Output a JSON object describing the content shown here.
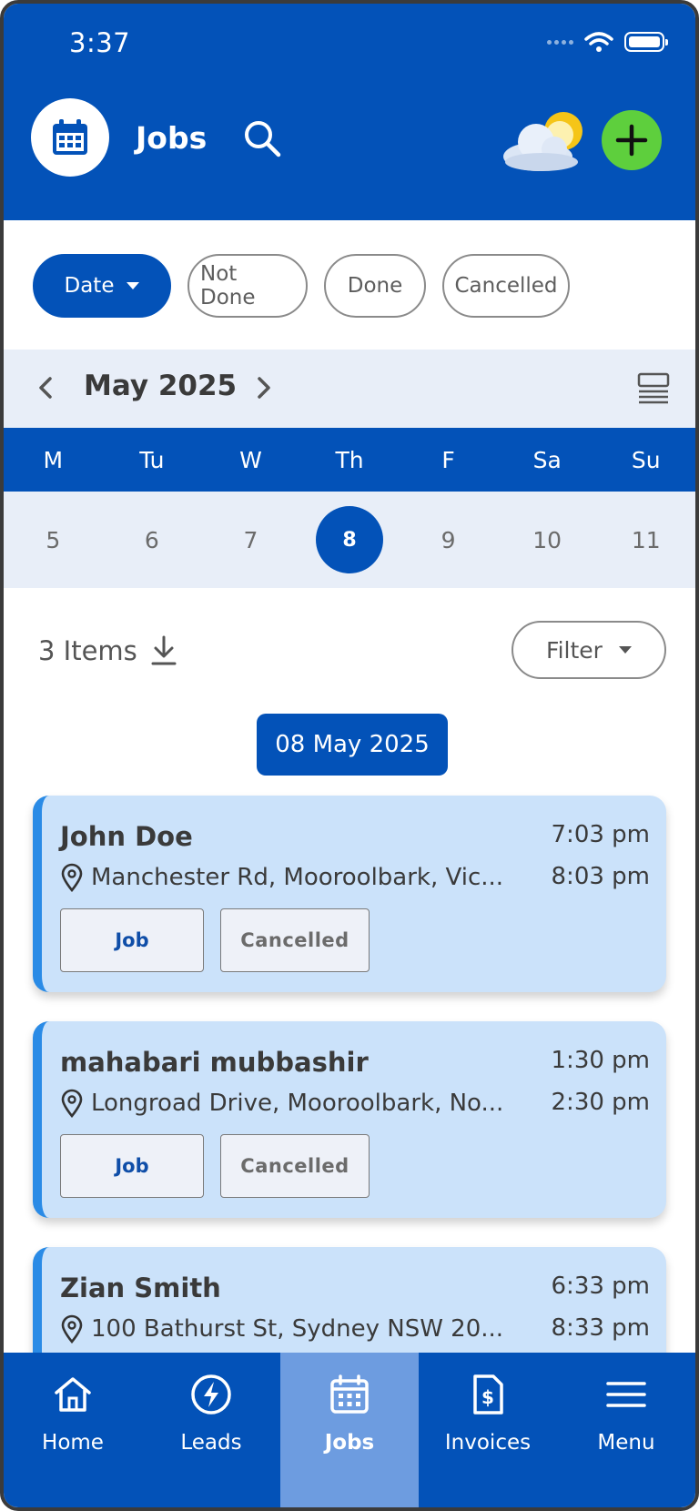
{
  "status_bar": {
    "time": "3:37"
  },
  "header": {
    "title": "Jobs"
  },
  "filters": {
    "chips": [
      {
        "label": "Date"
      },
      {
        "label": "Not Done"
      },
      {
        "label": "Done"
      },
      {
        "label": "Cancelled"
      }
    ]
  },
  "calendar": {
    "month_label": "May 2025",
    "weekdays": [
      "M",
      "Tu",
      "W",
      "Th",
      "F",
      "Sa",
      "Su"
    ],
    "dates": [
      "5",
      "6",
      "7",
      "8",
      "9",
      "10",
      "11"
    ],
    "selected_date": "8"
  },
  "list": {
    "count_label": "3 Items",
    "filter_label": "Filter",
    "date_group": "08 May 2025",
    "jobs": [
      {
        "name": "John Doe",
        "address": "Manchester Rd, Mooroolbark, Vic...",
        "start": "7:03 pm",
        "end": "8:03 pm",
        "type": "Job",
        "status": "Cancelled"
      },
      {
        "name": "mahabari mubbashir",
        "address": "Longroad Drive, Mooroolbark, No...",
        "start": "1:30 pm",
        "end": "2:30 pm",
        "type": "Job",
        "status": "Cancelled"
      },
      {
        "name": "Zian Smith",
        "address": "100 Bathurst St, Sydney NSW 20...",
        "start": "6:33 pm",
        "end": "8:33 pm"
      }
    ]
  },
  "nav": {
    "items": [
      {
        "label": "Home",
        "icon": "home-icon"
      },
      {
        "label": "Leads",
        "icon": "bolt-icon"
      },
      {
        "label": "Jobs",
        "icon": "calendar-icon"
      },
      {
        "label": "Invoices",
        "icon": "invoice-icon"
      },
      {
        "label": "Menu",
        "icon": "menu-icon"
      }
    ],
    "active": "Jobs"
  },
  "colors": {
    "brand": "#0352b8",
    "card": "#cbe2fa",
    "card_accent": "#2a8be6",
    "add_button": "#5ecf3d",
    "nav_active": "#6d9ce0"
  }
}
